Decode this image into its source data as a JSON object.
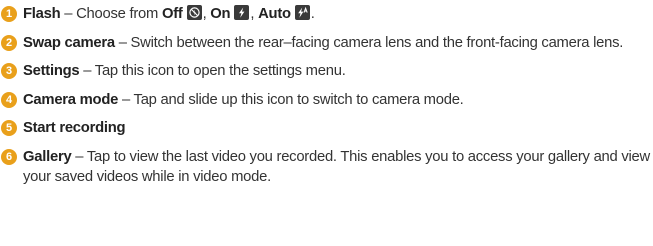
{
  "items": [
    {
      "number": "1",
      "term": "Flash",
      "dash": " – Choose from ",
      "options": [
        {
          "label": "Off",
          "icon": "flash-off-icon"
        },
        {
          "label": "On",
          "icon": "flash-on-icon"
        },
        {
          "label": "Auto",
          "icon": "flash-auto-icon"
        }
      ],
      "end": "."
    },
    {
      "number": "2",
      "term": "Swap camera",
      "desc": " – Switch between the rear–facing camera lens and the front-facing camera lens."
    },
    {
      "number": "3",
      "term": "Settings",
      "desc": " – Tap this icon to open the settings menu."
    },
    {
      "number": "4",
      "term": "Camera mode",
      "desc": " – Tap and slide up this icon to switch to camera mode."
    },
    {
      "number": "5",
      "term": "Start recording",
      "desc": ""
    },
    {
      "number": "6",
      "term": "Gallery",
      "desc": " – Tap to view the last video you recorded. This enables you to access your gallery and view your saved videos while in video mode."
    }
  ],
  "colors": {
    "bullet": "#e9a01b",
    "text": "#333333",
    "icon_bg": "#3a3a3a"
  }
}
